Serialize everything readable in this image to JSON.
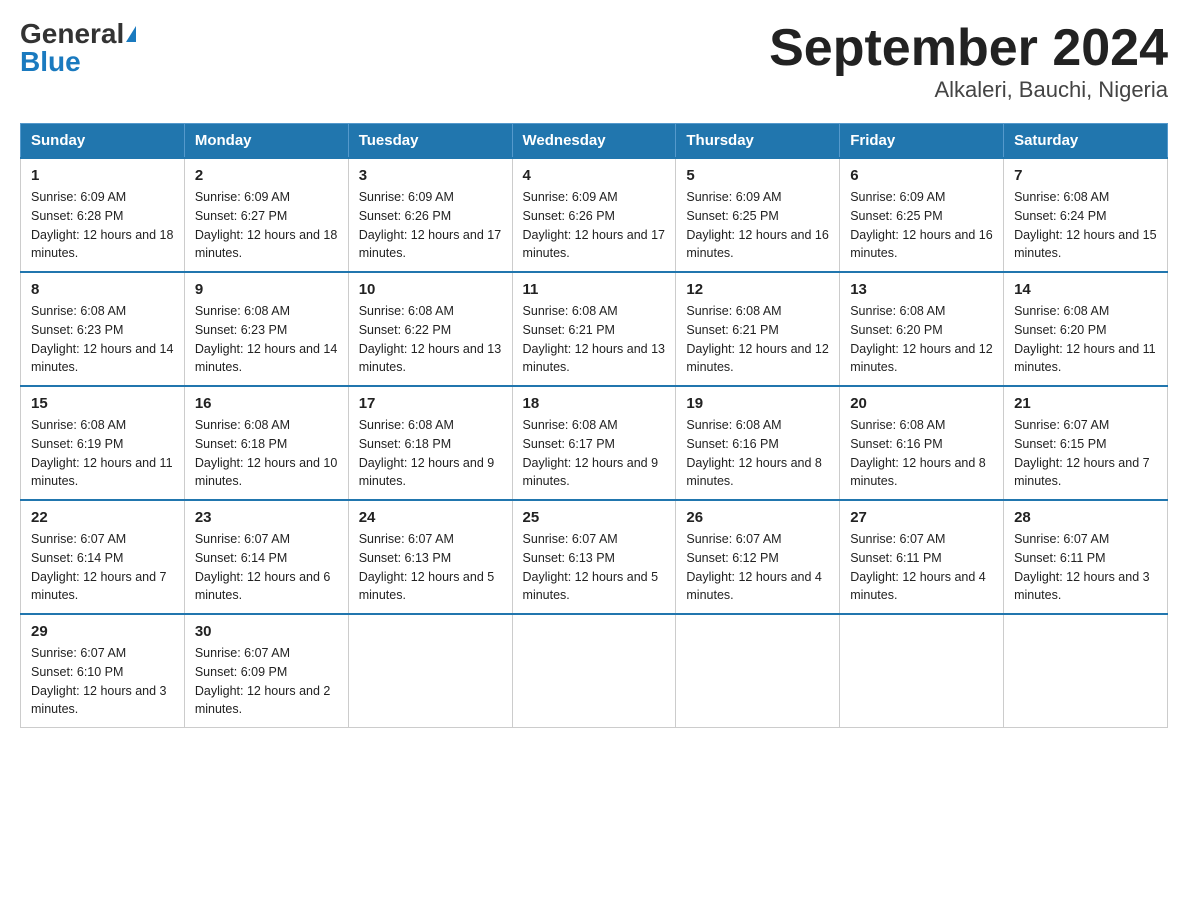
{
  "header": {
    "logo_general": "General",
    "logo_blue": "Blue",
    "title": "September 2024",
    "subtitle": "Alkaleri, Bauchi, Nigeria"
  },
  "calendar": {
    "days_of_week": [
      "Sunday",
      "Monday",
      "Tuesday",
      "Wednesday",
      "Thursday",
      "Friday",
      "Saturday"
    ],
    "weeks": [
      [
        {
          "day": "1",
          "sunrise": "6:09 AM",
          "sunset": "6:28 PM",
          "daylight": "12 hours and 18 minutes."
        },
        {
          "day": "2",
          "sunrise": "6:09 AM",
          "sunset": "6:27 PM",
          "daylight": "12 hours and 18 minutes."
        },
        {
          "day": "3",
          "sunrise": "6:09 AM",
          "sunset": "6:26 PM",
          "daylight": "12 hours and 17 minutes."
        },
        {
          "day": "4",
          "sunrise": "6:09 AM",
          "sunset": "6:26 PM",
          "daylight": "12 hours and 17 minutes."
        },
        {
          "day": "5",
          "sunrise": "6:09 AM",
          "sunset": "6:25 PM",
          "daylight": "12 hours and 16 minutes."
        },
        {
          "day": "6",
          "sunrise": "6:09 AM",
          "sunset": "6:25 PM",
          "daylight": "12 hours and 16 minutes."
        },
        {
          "day": "7",
          "sunrise": "6:08 AM",
          "sunset": "6:24 PM",
          "daylight": "12 hours and 15 minutes."
        }
      ],
      [
        {
          "day": "8",
          "sunrise": "6:08 AM",
          "sunset": "6:23 PM",
          "daylight": "12 hours and 14 minutes."
        },
        {
          "day": "9",
          "sunrise": "6:08 AM",
          "sunset": "6:23 PM",
          "daylight": "12 hours and 14 minutes."
        },
        {
          "day": "10",
          "sunrise": "6:08 AM",
          "sunset": "6:22 PM",
          "daylight": "12 hours and 13 minutes."
        },
        {
          "day": "11",
          "sunrise": "6:08 AM",
          "sunset": "6:21 PM",
          "daylight": "12 hours and 13 minutes."
        },
        {
          "day": "12",
          "sunrise": "6:08 AM",
          "sunset": "6:21 PM",
          "daylight": "12 hours and 12 minutes."
        },
        {
          "day": "13",
          "sunrise": "6:08 AM",
          "sunset": "6:20 PM",
          "daylight": "12 hours and 12 minutes."
        },
        {
          "day": "14",
          "sunrise": "6:08 AM",
          "sunset": "6:20 PM",
          "daylight": "12 hours and 11 minutes."
        }
      ],
      [
        {
          "day": "15",
          "sunrise": "6:08 AM",
          "sunset": "6:19 PM",
          "daylight": "12 hours and 11 minutes."
        },
        {
          "day": "16",
          "sunrise": "6:08 AM",
          "sunset": "6:18 PM",
          "daylight": "12 hours and 10 minutes."
        },
        {
          "day": "17",
          "sunrise": "6:08 AM",
          "sunset": "6:18 PM",
          "daylight": "12 hours and 9 minutes."
        },
        {
          "day": "18",
          "sunrise": "6:08 AM",
          "sunset": "6:17 PM",
          "daylight": "12 hours and 9 minutes."
        },
        {
          "day": "19",
          "sunrise": "6:08 AM",
          "sunset": "6:16 PM",
          "daylight": "12 hours and 8 minutes."
        },
        {
          "day": "20",
          "sunrise": "6:08 AM",
          "sunset": "6:16 PM",
          "daylight": "12 hours and 8 minutes."
        },
        {
          "day": "21",
          "sunrise": "6:07 AM",
          "sunset": "6:15 PM",
          "daylight": "12 hours and 7 minutes."
        }
      ],
      [
        {
          "day": "22",
          "sunrise": "6:07 AM",
          "sunset": "6:14 PM",
          "daylight": "12 hours and 7 minutes."
        },
        {
          "day": "23",
          "sunrise": "6:07 AM",
          "sunset": "6:14 PM",
          "daylight": "12 hours and 6 minutes."
        },
        {
          "day": "24",
          "sunrise": "6:07 AM",
          "sunset": "6:13 PM",
          "daylight": "12 hours and 5 minutes."
        },
        {
          "day": "25",
          "sunrise": "6:07 AM",
          "sunset": "6:13 PM",
          "daylight": "12 hours and 5 minutes."
        },
        {
          "day": "26",
          "sunrise": "6:07 AM",
          "sunset": "6:12 PM",
          "daylight": "12 hours and 4 minutes."
        },
        {
          "day": "27",
          "sunrise": "6:07 AM",
          "sunset": "6:11 PM",
          "daylight": "12 hours and 4 minutes."
        },
        {
          "day": "28",
          "sunrise": "6:07 AM",
          "sunset": "6:11 PM",
          "daylight": "12 hours and 3 minutes."
        }
      ],
      [
        {
          "day": "29",
          "sunrise": "6:07 AM",
          "sunset": "6:10 PM",
          "daylight": "12 hours and 3 minutes."
        },
        {
          "day": "30",
          "sunrise": "6:07 AM",
          "sunset": "6:09 PM",
          "daylight": "12 hours and 2 minutes."
        },
        null,
        null,
        null,
        null,
        null
      ]
    ]
  }
}
